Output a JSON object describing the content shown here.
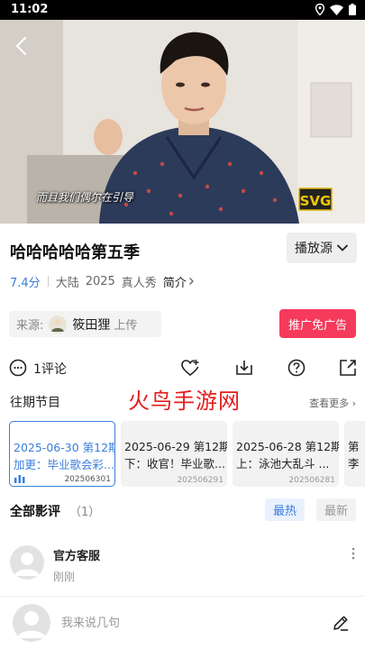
{
  "status_bar": {
    "time": "11:02",
    "icons": [
      "location-icon",
      "wifi-icon",
      "battery-icon"
    ]
  },
  "video": {
    "subtitle": "而且我们偶尔在引导",
    "logo_text": "SVG"
  },
  "show": {
    "title": "哈哈哈哈哈第五季",
    "source_button": "播放源",
    "score": "7.4分",
    "region": "大陆",
    "year": "2025",
    "genre": "真人秀",
    "intro_link": "简介"
  },
  "uploader": {
    "label": "来源:",
    "name": "筱田狸",
    "suffix": "上传"
  },
  "promo_button": "推广免广告",
  "actions": {
    "comment_count": "1评论",
    "icons": [
      "comment-icon",
      "favorite-icon",
      "download-icon",
      "help-icon",
      "share-icon"
    ]
  },
  "episodes_section": {
    "title": "往期节目",
    "watermark": "火鸟手游网",
    "more": "查看更多",
    "items": [
      {
        "line1": "2025-06-30 第12期",
        "line2": "加更：毕业歌会彩...",
        "code": "202506301",
        "active": true
      },
      {
        "line1": "2025-06-29 第12期",
        "line2": "下：收官！毕业歌...",
        "code": "202506291",
        "active": false
      },
      {
        "line1": "2025-06-28 第12期",
        "line2": "上：泳池大乱斗 ...",
        "code": "202506281",
        "active": false
      },
      {
        "line1": "第",
        "line2": "李",
        "code": "",
        "active": false
      }
    ]
  },
  "reviews": {
    "title": "全部影评",
    "count": "（1）",
    "sort_hot": "最热",
    "sort_new": "最新"
  },
  "comment": {
    "author": "官方客服",
    "time": "刚刚"
  },
  "bottom_bar": {
    "placeholder": "我来说几句"
  },
  "colors": {
    "accent": "#3b7ddd",
    "promo": "#f63a5c",
    "watermark": "#e41d1d"
  }
}
